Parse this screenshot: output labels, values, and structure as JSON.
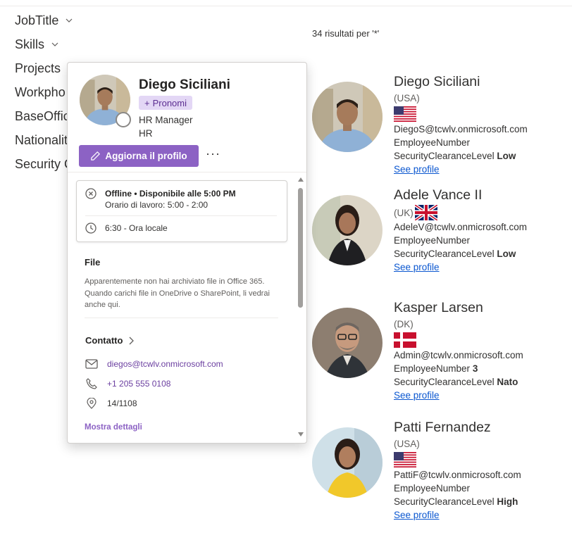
{
  "filters": [
    {
      "label": "JobTitle",
      "chevron": true
    },
    {
      "label": "Skills",
      "chevron": true
    },
    {
      "label": "Projects",
      "chevron": false
    },
    {
      "label": "Workpho",
      "chevron": false
    },
    {
      "label": "BaseOffic",
      "chevron": false
    },
    {
      "label": "Nationalit",
      "chevron": false
    },
    {
      "label": "Security C",
      "chevron": false
    }
  ],
  "results_count": "34 risultati per '*'",
  "results": [
    {
      "name": "Diego Siciliani",
      "country": "(USA)",
      "flag": "us-flag",
      "email": "DiegoS@tcwlv.onmicrosoft.com",
      "employee_label": "EmployeeNumber",
      "employee_value": "",
      "clearance_label": "SecurityClearanceLevel",
      "clearance_value": "Low",
      "link": "See profile"
    },
    {
      "name": "Adele Vance II",
      "country": "(UK)",
      "flag": "uk-flag",
      "email": "AdeleV@tcwlv.onmicrosoft.com",
      "employee_label": "EmployeeNumber",
      "employee_value": "",
      "clearance_label": "SecurityClearanceLevel",
      "clearance_value": "Low",
      "link": "See profile"
    },
    {
      "name": "Kasper Larsen",
      "country": "(DK)",
      "flag": "dk-flag",
      "email": "Admin@tcwlv.onmicrosoft.com",
      "employee_label": "EmployeeNumber",
      "employee_value": "3",
      "clearance_label": "SecurityClearanceLevel",
      "clearance_value": "Nato",
      "link": "See profile"
    },
    {
      "name": "Patti Fernandez",
      "country": "(USA)",
      "flag": "us-flag",
      "email": "PattiF@tcwlv.onmicrosoft.com",
      "employee_label": "EmployeeNumber",
      "employee_value": "",
      "clearance_label": "SecurityClearanceLevel",
      "clearance_value": "High",
      "link": "See profile"
    }
  ],
  "popup": {
    "name": "Diego Siciliani",
    "pronouns_label": "Pronomi",
    "job_title": "HR Manager",
    "department": "HR",
    "update_button": "Aggiorna il profilo",
    "more": "···",
    "status_line": "Offline • Disponibile alle 5:00 PM",
    "work_hours": "Orario di lavoro: 5:00 - 2:00",
    "local_time": "6:30 - Ora locale",
    "file_title": "File",
    "file_text": "Apparentemente non hai archiviato file in Office 365. Quando carichi file in OneDrive o SharePoint, li vedrai anche qui.",
    "contact_title": "Contatto",
    "email": "diegos@tcwlv.onmicrosoft.com",
    "phone": "+1 205 555 0108",
    "office": "14/1108",
    "show_details": "Mostra dettagli"
  },
  "colors": {
    "accent": "#8c62c4",
    "link": "#0b57d0",
    "pronoun_bg": "#e3d7f5"
  }
}
